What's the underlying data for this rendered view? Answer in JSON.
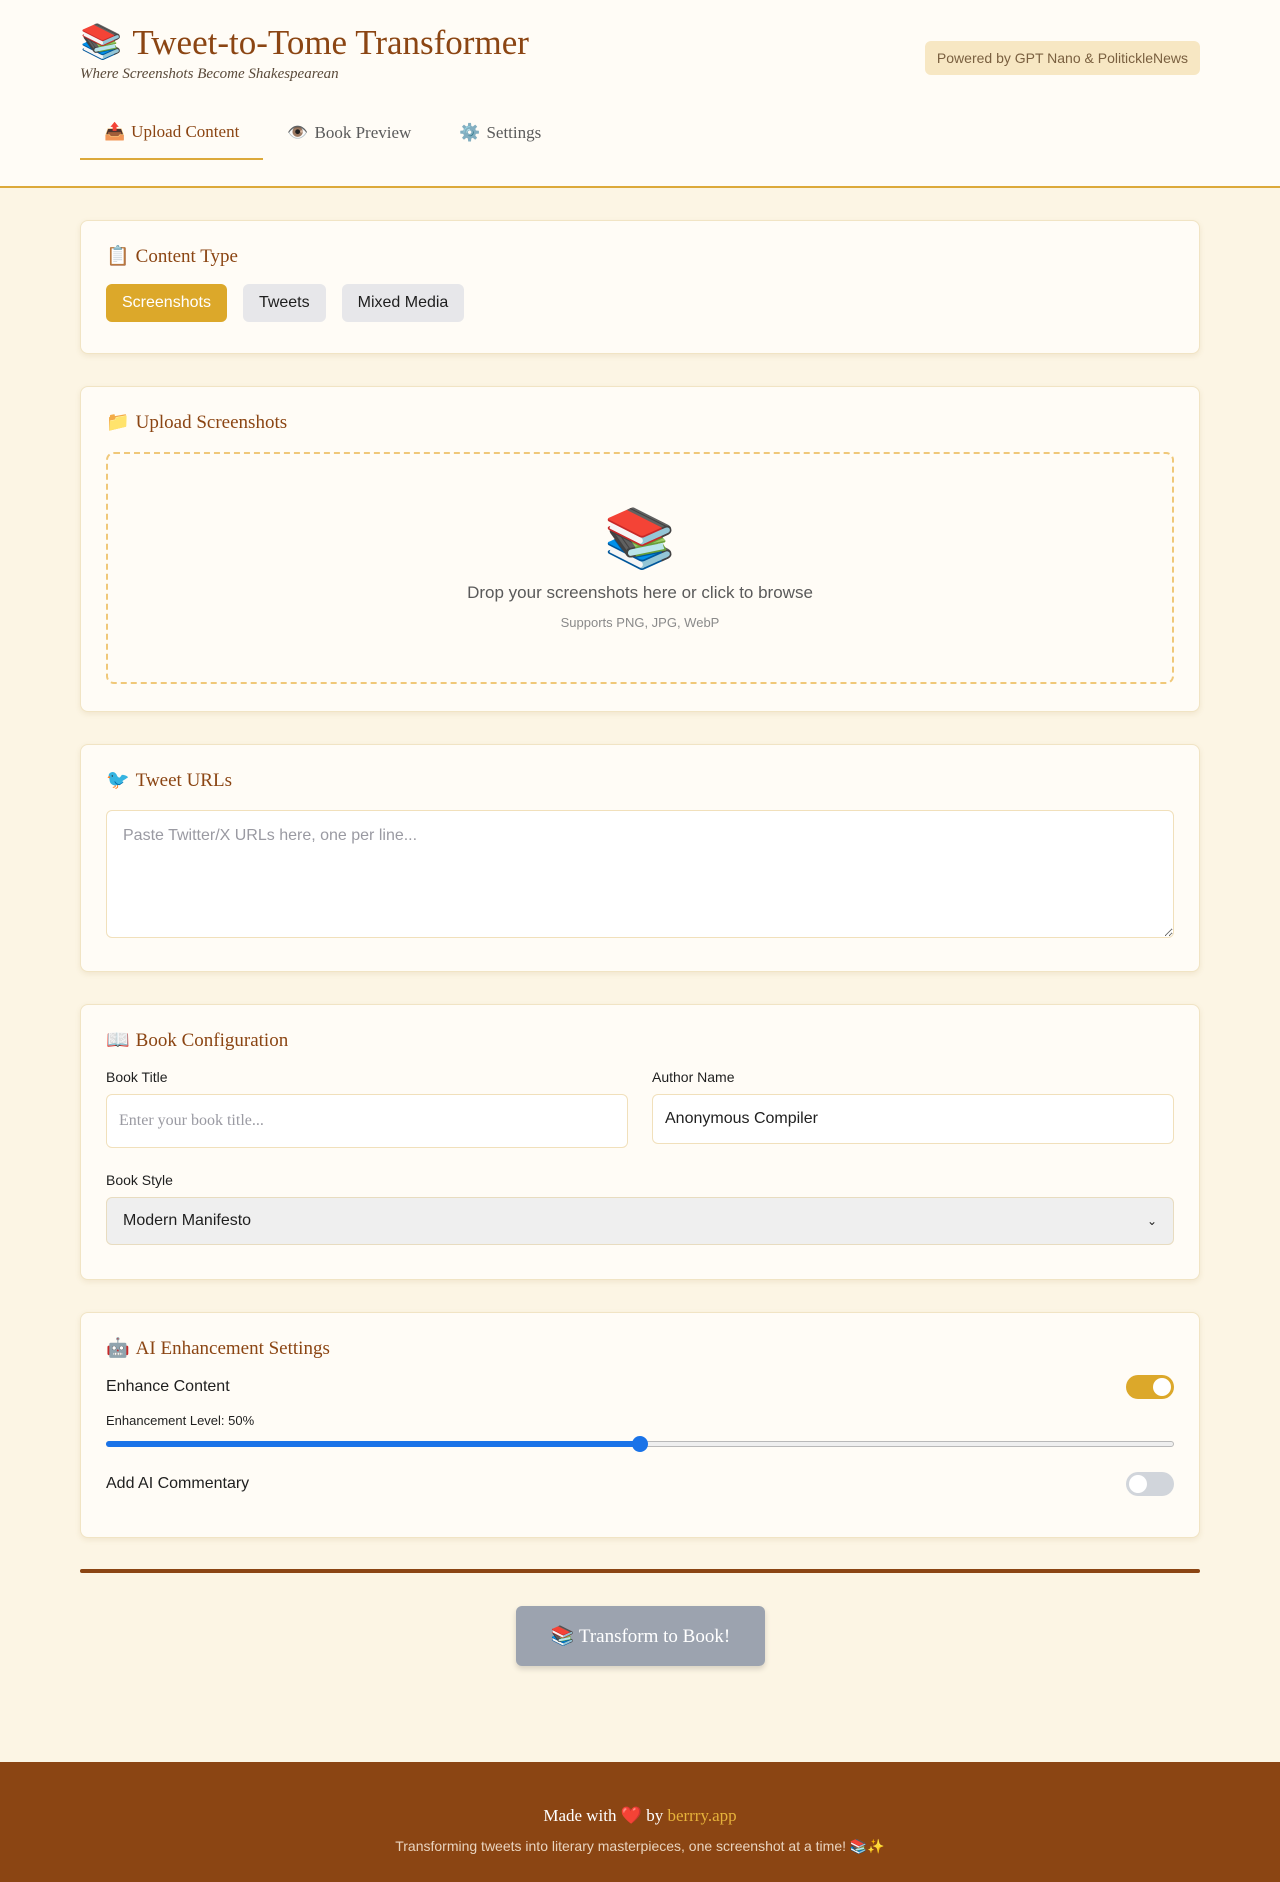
{
  "header": {
    "title_emoji": "📚",
    "title": "Tweet-to-Tome Transformer",
    "subtitle": "Where Screenshots Become Shakespearean",
    "powered_by": "Powered by GPT Nano & PolitickleNews"
  },
  "tabs": [
    {
      "icon": "📤",
      "label": "Upload Content",
      "active": true
    },
    {
      "icon": "👁️",
      "label": "Book Preview",
      "active": false
    },
    {
      "icon": "⚙️",
      "label": "Settings",
      "active": false
    }
  ],
  "content_type": {
    "icon": "📋",
    "title": "Content Type",
    "options": [
      "Screenshots",
      "Tweets",
      "Mixed Media"
    ],
    "selected": "Screenshots"
  },
  "upload": {
    "icon": "📁",
    "title": "Upload Screenshots",
    "drop_icon": "📚",
    "drop_text": "Drop your screenshots here or click to browse",
    "drop_sub": "Supports PNG, JPG, WebP"
  },
  "tweet_urls": {
    "icon": "🐦",
    "title": "Tweet URLs",
    "placeholder": "Paste Twitter/X URLs here, one per line..."
  },
  "book_config": {
    "icon": "📖",
    "title": "Book Configuration",
    "title_label": "Book Title",
    "title_placeholder": "Enter your book title...",
    "author_label": "Author Name",
    "author_value": "Anonymous Compiler",
    "style_label": "Book Style",
    "style_value": "Modern Manifesto"
  },
  "ai_settings": {
    "icon": "🤖",
    "title": "AI Enhancement Settings",
    "enhance_label": "Enhance Content",
    "enhance_on": true,
    "level_label": "Enhancement Level: 50%",
    "level_value": 0.5,
    "commentary_label": "Add AI Commentary",
    "commentary_on": false
  },
  "actions": {
    "transform_label": "📚 Transform to Book!"
  },
  "footer": {
    "made_with": "Made with",
    "heart": "❤️",
    "by": "by",
    "link": "berrry.app",
    "tagline": "Transforming tweets into literary masterpieces, one screenshot at a time! 📚✨"
  },
  "colors": {
    "accent": "#dca82a",
    "brand": "#8b4513",
    "background": "#fcf5e4",
    "slider": "#1a73e8"
  }
}
